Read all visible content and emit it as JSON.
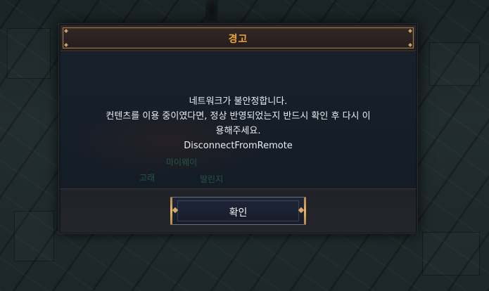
{
  "dialog": {
    "title": "경고",
    "message_lines": [
      "네트워크가 불안정합니다.",
      "컨텐츠를 이용 중이였다면, 정상 반영되었는지 반드시 확인 후 다시 이",
      "용해주세요.",
      "DisconnectFromRemote"
    ],
    "confirm_label": "확인"
  },
  "background_text": {
    "line1": "마이웨이",
    "line2": "고래",
    "line3": "딸린지"
  },
  "colors": {
    "title": "#f0a63a",
    "message": "#e9eef2",
    "button_edge": "#e6b56a"
  }
}
